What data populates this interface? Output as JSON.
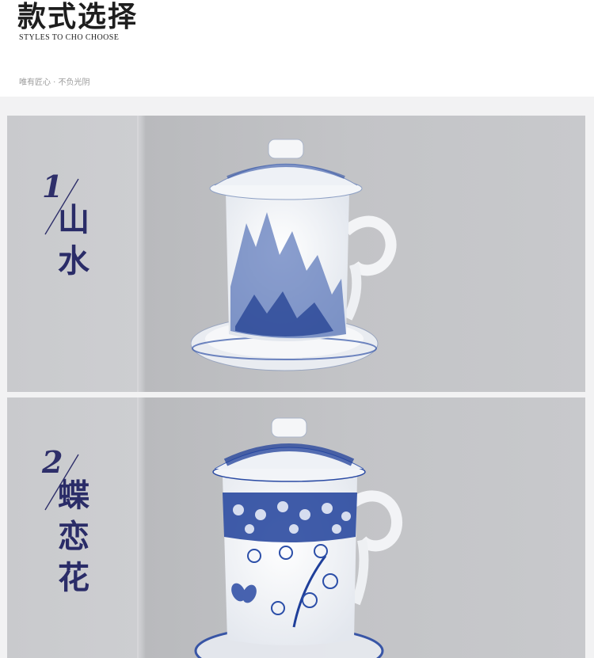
{
  "header": {
    "title": "款式选择",
    "subtitle": "STYLES TO CHO CHOOSE",
    "tagline": "唯有匠心 · 不负光阴"
  },
  "styles": [
    {
      "number": "1",
      "name": "山水"
    },
    {
      "number": "2",
      "name": "蝶恋花"
    }
  ],
  "colors": {
    "accent": "#2e2f6a",
    "page_bg": "#f2f2f3",
    "porcelain_blue": "#1f3f9a"
  }
}
